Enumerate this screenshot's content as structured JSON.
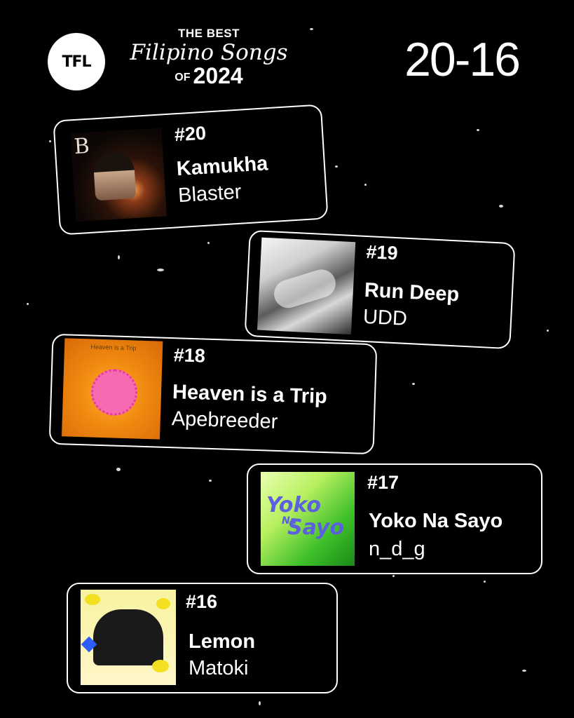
{
  "header": {
    "logo_text": "TFL",
    "line1": "THE BEST",
    "line2": "Filipino Songs",
    "line3_of": "OF",
    "line3_year": "2024",
    "range": "20-16"
  },
  "songs": [
    {
      "rank": "#20",
      "title": "Kamukha",
      "artist": "Blaster",
      "art_letter": "B"
    },
    {
      "rank": "#19",
      "title": "Run Deep",
      "artist": "UDD"
    },
    {
      "rank": "#18",
      "title": "Heaven is a Trip",
      "artist": "Apebreeder",
      "art_text": "Heaven is a Trip"
    },
    {
      "rank": "#17",
      "title": "Yoko Na Sayo",
      "artist": "n_d_g",
      "art_line1": "Yoko",
      "art_line2": "Na",
      "art_line3": "Sayo"
    },
    {
      "rank": "#16",
      "title": "Lemon",
      "artist": "Matoki"
    }
  ],
  "colors": {
    "background": "#000000",
    "foreground": "#ffffff"
  }
}
